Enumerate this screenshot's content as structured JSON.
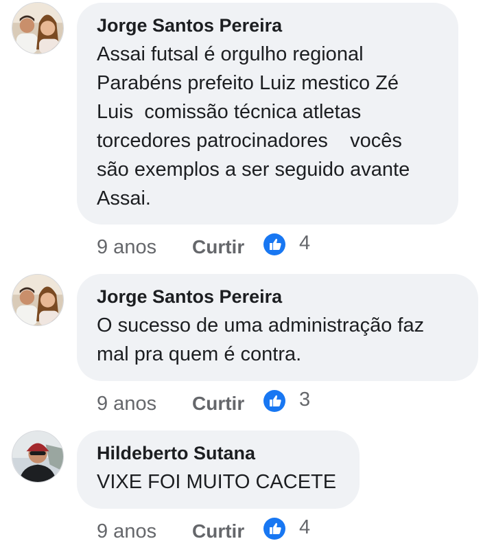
{
  "comments": [
    {
      "author": "Jorge Santos Pereira",
      "text": "Assai futsal é orgulho regional\nParabéns prefeito Luiz mestico Zé\nLuis  comissão técnica atletas\ntorcedores patrocinadores    vocês\nsão exemplos a ser seguido avante\nAssai.",
      "time": "9 anos",
      "like_label": "Curtir",
      "reaction_count": "4",
      "reaction_icon": "like-icon",
      "avatar": "couple-photo"
    },
    {
      "author": "Jorge Santos Pereira",
      "text": "O sucesso de uma administração faz\nmal pra quem é contra.",
      "time": "9 anos",
      "like_label": "Curtir",
      "reaction_count": "3",
      "reaction_icon": "like-icon",
      "avatar": "couple-photo"
    },
    {
      "author": "Hildeberto Sutana",
      "text": "VIXE FOI MUITO CACETE",
      "time": "9 anos",
      "like_label": "Curtir",
      "reaction_count": "4",
      "reaction_icon": "like-icon",
      "avatar": "man-cap-photo"
    }
  ],
  "colors": {
    "bubble": "#f0f2f5",
    "like_blue": "#1877f2",
    "meta_gray": "#65676b",
    "text": "#1c1e21"
  }
}
